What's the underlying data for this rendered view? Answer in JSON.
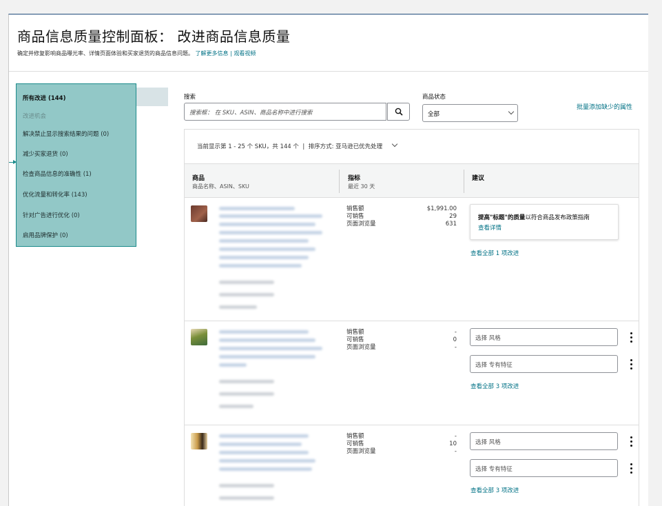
{
  "header": {
    "title": "商品信息质量控制面板： 改进商品信息质量",
    "subtitle": "确定并修复影响商品曝光率、详情页面体验和买家退货的商品信息问题。",
    "learn_more": "了解更多信息",
    "separator": "|",
    "watch_video": "观看视频"
  },
  "sidebar": {
    "items": [
      {
        "label": "所有改进 (144)"
      },
      {
        "label": "改进机会"
      },
      {
        "label": "解决禁止显示搜索结果的问题 (0)"
      },
      {
        "label": "减少买家退货 (0)"
      },
      {
        "label": "检查商品信息的准确性 (1)"
      },
      {
        "label": "优化流量和转化率 (143)"
      },
      {
        "label": "针对广告进行优化 (0)"
      },
      {
        "label": "启用品牌保护 (0)"
      }
    ]
  },
  "search": {
    "label": "搜索",
    "placeholder": "搜索框： 在 SKU、ASIN、商品名称中进行搜索",
    "icon": "search-icon"
  },
  "status": {
    "label": "商品状态",
    "selected": "全部"
  },
  "bulk_link": "批量添加缺少的属性",
  "table": {
    "showing": "当前显示第 1 - 25 个 SKU，共 144 个",
    "sep": "|",
    "sort_label": "排序方式:",
    "sort_value": "亚马逊已优先处理",
    "columns": {
      "product": {
        "title": "商品",
        "sub": "商品名称、ASIN、SKU"
      },
      "metrics": {
        "title": "指标",
        "sub": "最近 30 天"
      },
      "recs": {
        "title": "建议"
      }
    },
    "metric_labels": [
      "销售额",
      "可销售",
      "页面浏览量"
    ],
    "rows": [
      {
        "values": [
          "$1,991.00",
          "29",
          "631"
        ],
        "rec_bold": "提高\"标题\"的质量",
        "rec_rest": "以符合商品发布政策指南",
        "rec_link": "查看详情",
        "view_all": "查看全部 1 项改进"
      },
      {
        "values": [
          "-",
          "0",
          "-"
        ],
        "select1": "选择 风格",
        "select2": "选择 专有特征",
        "view_all": "查看全部 3 项改进"
      },
      {
        "values": [
          "-",
          "10",
          "-"
        ],
        "select1": "选择 风格",
        "select2": "选择 专有特征",
        "view_all": "查看全部 3 项改进"
      }
    ]
  },
  "colors": {
    "link": "#007185",
    "highlight": "#92c8c7",
    "highlight_border": "#1b8a8a"
  }
}
